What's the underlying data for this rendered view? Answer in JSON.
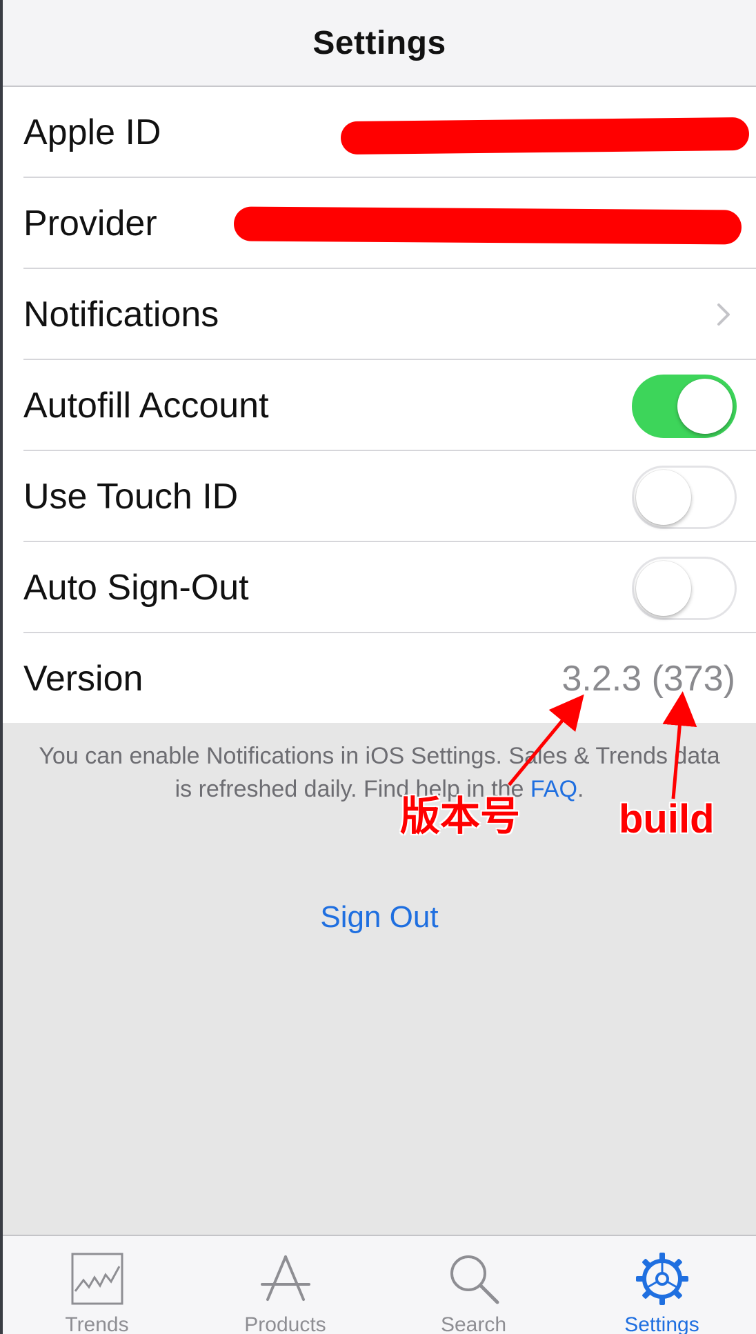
{
  "navbar": {
    "title": "Settings"
  },
  "rows": {
    "apple_id": {
      "label": "Apple ID"
    },
    "provider": {
      "label": "Provider"
    },
    "notifications": {
      "label": "Notifications"
    },
    "autofill": {
      "label": "Autofill Account",
      "on": true
    },
    "touch_id": {
      "label": "Use Touch ID",
      "on": false
    },
    "auto_signout": {
      "label": "Auto Sign-Out",
      "on": false
    },
    "version": {
      "label": "Version",
      "value": "3.2.3 (373)"
    }
  },
  "footer": {
    "line1": "You can enable Notifications in iOS Settings. Sales & Trends data",
    "line2_prefix": "is refreshed daily. Find help in the ",
    "faq_link": "FAQ",
    "line2_suffix": "."
  },
  "sign_out_label": "Sign Out",
  "annotations": {
    "version_number": "版本号",
    "build": "build",
    "color": "#ff0000"
  },
  "tabbar": {
    "tabs": [
      {
        "label": "Trends",
        "icon": "trends-chart-icon"
      },
      {
        "label": "Products",
        "icon": "app-store-icon"
      },
      {
        "label": "Search",
        "icon": "search-icon"
      },
      {
        "label": "Settings",
        "icon": "gear-icon",
        "active": true
      }
    ],
    "active_color": "#1f6fe0"
  },
  "colors": {
    "switch_on": "#3dd55a",
    "link": "#1f6fe0"
  }
}
